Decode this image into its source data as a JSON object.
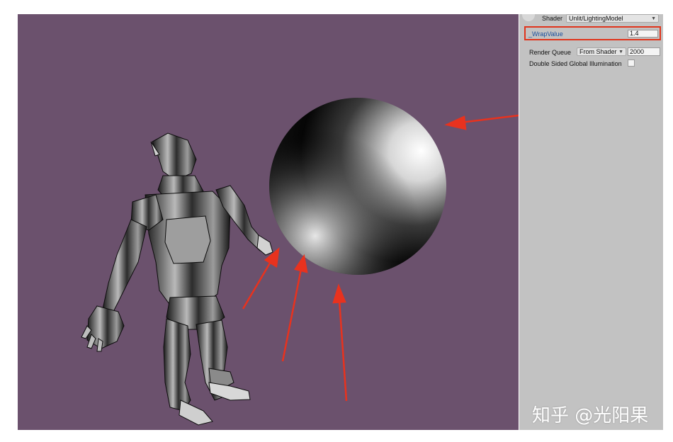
{
  "inspector": {
    "shader_label": "Shader",
    "shader_value": "Unlit/LightingModel",
    "wrap_label": "_WrapValue",
    "wrap_value": "1.4",
    "render_queue_label": "Render Queue",
    "render_queue_mode": "From Shader",
    "render_queue_value": "2000",
    "dsgi_label": "Double Sided Global Illumination",
    "dsgi_checked": false
  },
  "watermark": "知乎 @光阳果",
  "colors": {
    "viewport_bg": "#6b516d",
    "inspector_bg": "#c2c2c2",
    "highlight": "#e0341c",
    "arrow": "#e8321e"
  },
  "icons": [
    "dropdown-arrow-icon"
  ]
}
